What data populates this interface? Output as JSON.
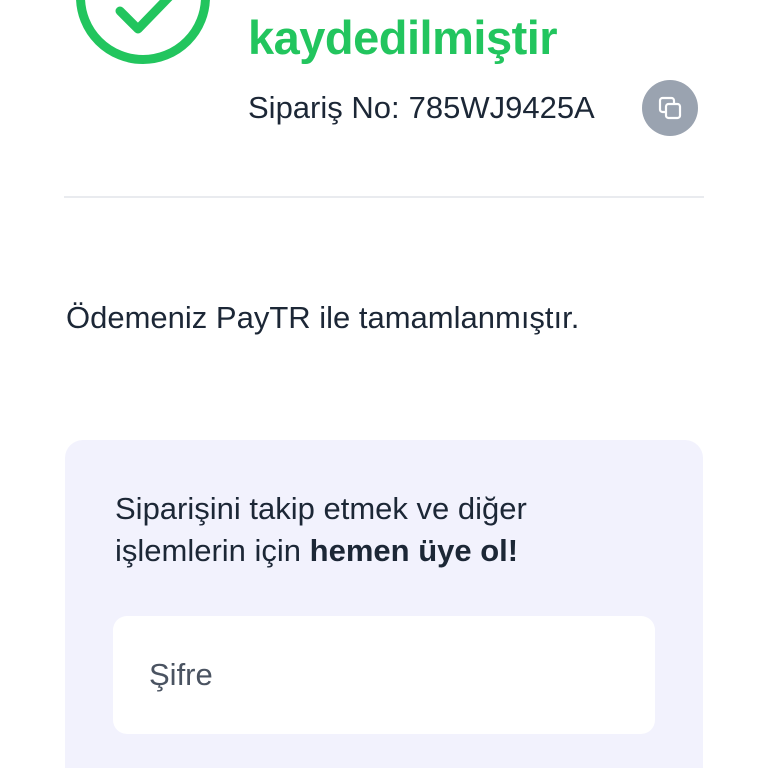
{
  "header": {
    "title_visible_line": "kaydedilmiştir",
    "status_icon": "check-circle-icon",
    "order_number_label": "Sipariş No:",
    "order_number": "785WJ9425A",
    "copy_icon": "copy-icon"
  },
  "payment": {
    "message": "Ödemeniz PayTR ile tamamlanmıştır."
  },
  "signup_card": {
    "text_line1": "Siparişini takip etmek ve diğer",
    "text_line2_prefix": "işlemlerin için ",
    "text_line2_bold": "hemen üye ol!",
    "password_placeholder": "Şifre"
  },
  "colors": {
    "success_green": "#22c55e",
    "text_dark": "#1c2736",
    "copy_button_gray": "#9aa3b0",
    "card_background": "#f2f2fd",
    "divider": "#e9ebef"
  }
}
